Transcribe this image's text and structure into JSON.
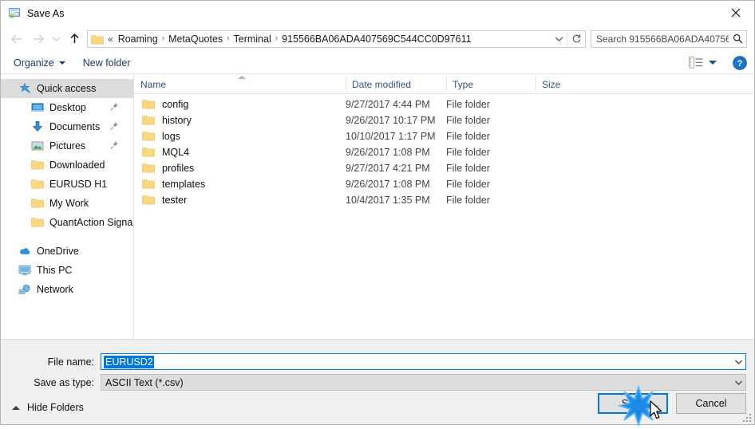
{
  "window": {
    "title": "Save As",
    "icon": "save-as-app-icon",
    "close_label": "✕"
  },
  "navigation": {
    "back_icon": "arrow-left-icon",
    "forward_icon": "arrow-right-icon",
    "recent_icon": "chevron-down-icon",
    "up_icon": "arrow-up-icon",
    "address": {
      "folder_icon": "folder-icon",
      "overflow": "«",
      "crumbs": [
        "Roaming",
        "MetaQuotes",
        "Terminal",
        "915566BA06ADA407569C544CC0D97611"
      ],
      "separator": "›",
      "dropdown_icon": "chevron-down-icon",
      "refresh_icon": "refresh-icon"
    },
    "search": {
      "placeholder": "Search 915566BA06ADA40756...",
      "icon": "search-icon"
    }
  },
  "toolbar": {
    "organize_label": "Organize",
    "new_folder_label": "New folder",
    "view_icon": "view-layout-icon",
    "view_caret_icon": "chevron-down-icon",
    "help_icon": "help-circle-icon"
  },
  "sidebar": {
    "items": [
      {
        "label": "Quick access",
        "icon": "star-pin-icon",
        "selected": true,
        "level": 1,
        "pinned": false
      },
      {
        "label": "Desktop",
        "icon": "desktop-icon",
        "selected": false,
        "level": 2,
        "pinned": true
      },
      {
        "label": "Documents",
        "icon": "documents-download-icon",
        "selected": false,
        "level": 2,
        "pinned": true
      },
      {
        "label": "Pictures",
        "icon": "pictures-icon",
        "selected": false,
        "level": 2,
        "pinned": true
      },
      {
        "label": "Downloaded",
        "icon": "folder-icon",
        "selected": false,
        "level": 2,
        "pinned": false
      },
      {
        "label": "EURUSD H1",
        "icon": "folder-icon",
        "selected": false,
        "level": 2,
        "pinned": false
      },
      {
        "label": "My Work",
        "icon": "folder-icon",
        "selected": false,
        "level": 2,
        "pinned": false
      },
      {
        "label": "QuantAction Signal",
        "icon": "folder-icon",
        "selected": false,
        "level": 2,
        "pinned": false
      }
    ],
    "groups": [
      {
        "label": "OneDrive",
        "icon": "onedrive-cloud-icon"
      },
      {
        "label": "This PC",
        "icon": "this-pc-icon"
      },
      {
        "label": "Network",
        "icon": "network-icon"
      }
    ]
  },
  "filelist": {
    "columns": {
      "name": "Name",
      "date_modified": "Date modified",
      "type": "Type",
      "size": "Size"
    },
    "sort_indicator": "sort-ascending-caret",
    "rows": [
      {
        "name": "config",
        "date": "9/27/2017 4:44 PM",
        "type": "File folder",
        "size": "",
        "icon": "folder-icon"
      },
      {
        "name": "history",
        "date": "9/26/2017 10:17 PM",
        "type": "File folder",
        "size": "",
        "icon": "folder-icon"
      },
      {
        "name": "logs",
        "date": "10/10/2017 1:17 PM",
        "type": "File folder",
        "size": "",
        "icon": "folder-icon"
      },
      {
        "name": "MQL4",
        "date": "9/26/2017 1:08 PM",
        "type": "File folder",
        "size": "",
        "icon": "folder-icon"
      },
      {
        "name": "profiles",
        "date": "9/27/2017 4:21 PM",
        "type": "File folder",
        "size": "",
        "icon": "folder-icon"
      },
      {
        "name": "templates",
        "date": "9/26/2017 1:08 PM",
        "type": "File folder",
        "size": "",
        "icon": "folder-icon"
      },
      {
        "name": "tester",
        "date": "10/4/2017 1:35 PM",
        "type": "File folder",
        "size": "",
        "icon": "folder-icon"
      }
    ]
  },
  "footer": {
    "file_name_label": "File name:",
    "file_name_value": "EURUSD2",
    "file_name_caret": "chevron-down-icon",
    "save_as_type_label": "Save as type:",
    "save_as_type_value": "ASCII Text (*.csv)",
    "save_as_type_caret": "chevron-down-icon",
    "hide_folders_label": "Hide Folders",
    "hide_folders_icon": "chevron-up-icon",
    "save_label": "Save",
    "cancel_label": "Cancel",
    "resize_grip": "resize-grip-icon"
  },
  "colors": {
    "accent": "#0078d7",
    "folder_yellow": "#fcd77f",
    "toolbar_link": "#1b3a63",
    "column_header": "#33557a",
    "footer_bg": "#f0f0f0",
    "selection_bg": "#dcdcdc"
  },
  "pointer": {
    "cursor_icon": "mouse-pointer-icon",
    "click_effect": "click-burst-icon"
  }
}
